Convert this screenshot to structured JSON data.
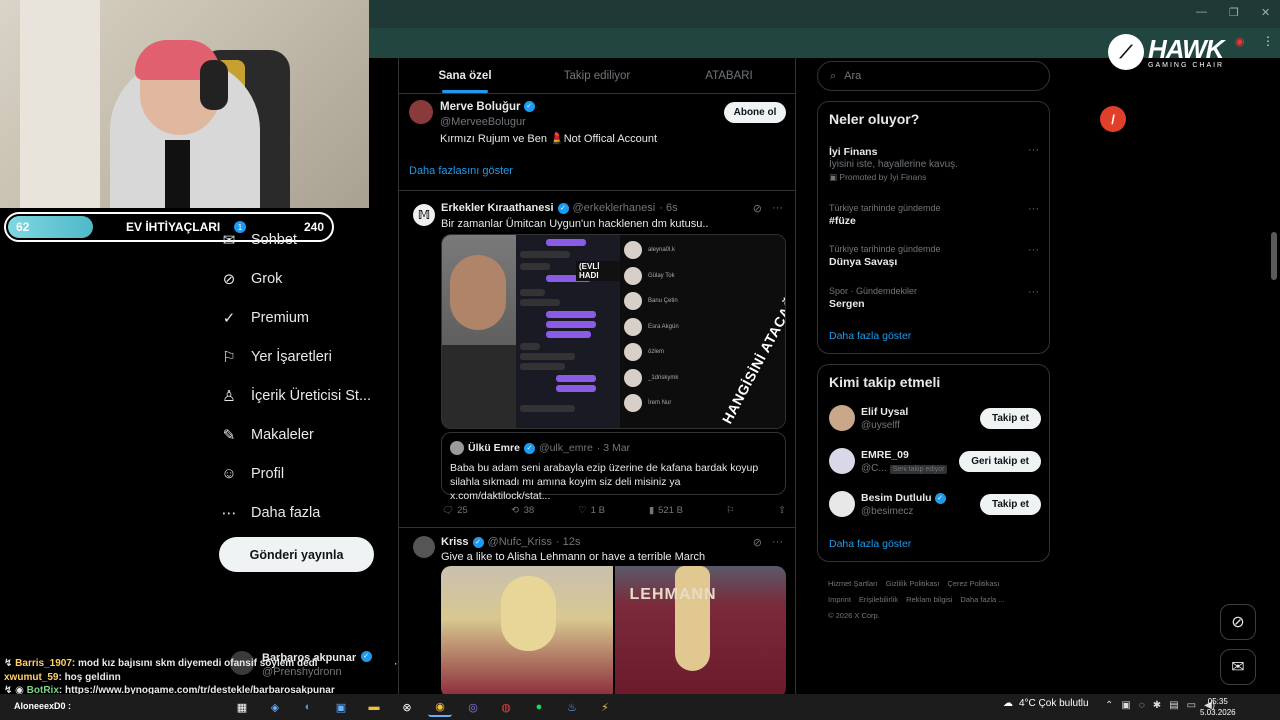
{
  "overlay": {
    "needs_left": "62",
    "needs_title": "EV İHTİYAÇLARI",
    "needs_right": "240",
    "needs_fill_fraction": 0.26
  },
  "brand": {
    "name": "HAWK",
    "sub": "GAMING CHAIR"
  },
  "nav": {
    "badge": "1",
    "items": [
      {
        "label": "Sohbet",
        "icon": "mail-icon",
        "glyph": "✉"
      },
      {
        "label": "Grok",
        "icon": "grok-icon",
        "glyph": "⊘"
      },
      {
        "label": "Premium",
        "icon": "premium-icon",
        "glyph": "✓"
      },
      {
        "label": "Yer İşaretleri",
        "icon": "bookmark-icon",
        "glyph": "⚐"
      },
      {
        "label": "İçerik Üreticisi St...",
        "icon": "creator-icon",
        "glyph": "♙"
      },
      {
        "label": "Makaleler",
        "icon": "article-icon",
        "glyph": "✎"
      },
      {
        "label": "Profil",
        "icon": "profile-icon",
        "glyph": "☺"
      },
      {
        "label": "Daha fazla",
        "icon": "more-icon",
        "glyph": "⋯"
      }
    ],
    "post_button": "Gönderi yayınla"
  },
  "me": {
    "name": "Barbaros akpunar",
    "handle": "@Prenshydronn"
  },
  "chat": [
    {
      "user": "Barris_1907",
      "msg": ": mod kız bajısını skm diyemedi ofansif söylem dedi"
    },
    {
      "user": "xwumut_59",
      "msg": ": hoş geldinn"
    },
    {
      "user": "BotRix",
      "msg": ": https://www.bynogame.com/tr/destekle/barbarosakpunar"
    },
    {
      "user": "AloneeexD0",
      "msg": ":"
    }
  ],
  "feed": {
    "tabs": [
      "Sana özel",
      "Takip ediliyor",
      "ATABARI"
    ],
    "rec": {
      "name": "Merve Boluğur",
      "handle": "@MerveeBolugur",
      "bio": "Kırmızı Rujum ve Ben 💄Not Offical Account",
      "button": "Abone ol",
      "more": "Daha fazlasını göster"
    },
    "post1": {
      "name": "Erkekler Kıraathanesi",
      "handle": "@erkeklerhanesi",
      "time": "· 6s",
      "text": "Bir zamanlar Ümitcan Uygun'un hacklenen dm kutusu..",
      "media_tag": "(EVLİ HADI",
      "media_stamp": "HANGİSİNİ ATACAĞIMI ŞAŞIRDIM..",
      "list_names": [
        "aleyna0l.k",
        "Gülay Tok",
        "Banu Çetin",
        "Esra Akgün",
        "özlem",
        "_1driskymk",
        "İrem Nur"
      ],
      "quote": {
        "name": "Ülkü Emre",
        "handle": "@ulk_emre",
        "time": "· 3 Mar",
        "text": "Baba bu adam seni arabayla ezip üzerine de kafana bardak koyup silahla sıkmadı mı amına koyim siz deli misiniz ya x.com/daktilock/stat..."
      },
      "stats": {
        "replies": "25",
        "reposts": "38",
        "likes": "1 B",
        "views": "521 B"
      }
    },
    "post2": {
      "name": "Kriss",
      "handle": "@Nufc_Kriss",
      "time": "· 12s",
      "text": "Give a like to Alisha Lehmann or have a terrible March",
      "jersey": "LEHMANN"
    }
  },
  "right": {
    "search_placeholder": "Ara",
    "whats_happening": {
      "title": "Neler oluyor?",
      "trends": [
        {
          "title": "İyi Finans",
          "sub": "İyisini iste, hayallerine kavuş.",
          "promo": "Promoted by İyi Finans"
        },
        {
          "cat": "Türkiye tarihinde gündemde",
          "title": "#füze"
        },
        {
          "cat": "Türkiye tarihinde gündemde",
          "title": "Dünya Savaşı"
        },
        {
          "cat": "Spor · Gündemdekiler",
          "title": "Sergen"
        }
      ],
      "more": "Daha fazla göster"
    },
    "who_to_follow": {
      "title": "Kimi takip etmeli",
      "people": [
        {
          "name": "Elif Uysal",
          "handle": "@uyselff",
          "button": "Takip et",
          "tag": ""
        },
        {
          "name": "EMRE_09",
          "handle": "@C...",
          "button": "Geri takip et",
          "tag": "Seni takip ediyor"
        },
        {
          "name": "Besim Dutlulu",
          "handle": "@besimecz",
          "button": "Takip et",
          "tag": ""
        }
      ],
      "more": "Daha fazla göster"
    },
    "footer": [
      "Hizmet Şartları",
      "Gizlilik Politikası",
      "Çerez Politikası",
      "Imprint",
      "Erişilebilirlik",
      "Reklam bilgisi",
      "Daha fazla ...",
      "© 2026 X Corp."
    ]
  },
  "taskbar": {
    "user": "AloneeexD0 :",
    "weather": "4°C  Çok bulutlu",
    "time": "05:35",
    "date": "5.03.2026"
  },
  "colors": {
    "accent": "#1d9bf0",
    "bg": "#000000",
    "text": "#e7e9ea",
    "muted": "#71767b",
    "chrome": "#214640"
  }
}
